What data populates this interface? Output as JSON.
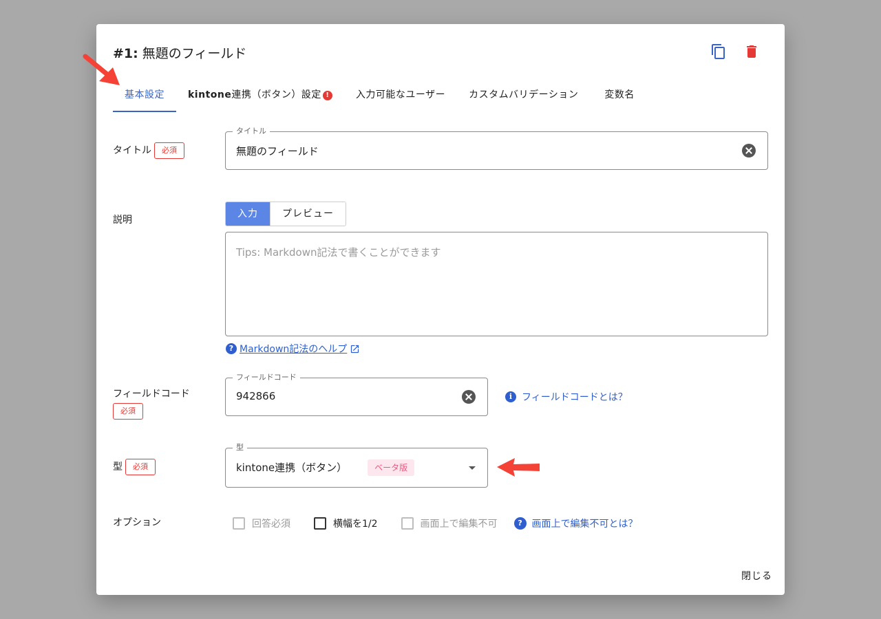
{
  "header": {
    "number": "#1:",
    "title": "無題のフィールド"
  },
  "tabs": [
    {
      "label": "基本設定"
    },
    {
      "bold": "kintone",
      "label": "連携（ボタン）設定",
      "warn": "!"
    },
    {
      "label": "入力可能なユーザー"
    },
    {
      "label": "カスタムバリデーション"
    },
    {
      "label": "変数名"
    }
  ],
  "required_label": "必須",
  "title_field": {
    "label": "タイトル",
    "legend": "タイトル",
    "value": "無題のフィールド"
  },
  "description": {
    "label": "説明",
    "toggle_input": "入力",
    "toggle_preview": "プレビュー",
    "placeholder": "Tips: Markdown記法で書くことができます",
    "help_link": "Markdown記法のヘルプ"
  },
  "field_code": {
    "label": "フィールドコード",
    "legend": "フィールドコード",
    "value": "942866",
    "info_link": "フィールドコードとは？"
  },
  "type_field": {
    "label": "型",
    "legend": "型",
    "value": "kintone連携（ボタン）",
    "badge": "ベータ版"
  },
  "options": {
    "label": "オプション",
    "items": [
      {
        "label": "回答必須",
        "checked": false,
        "disabled": true
      },
      {
        "label": "横幅を1/2",
        "checked": false,
        "disabled": false
      },
      {
        "label": "画面上で編集不可",
        "checked": false,
        "disabled": true
      }
    ],
    "help_link": "画面上で編集不可とは？"
  },
  "footer": {
    "close_label": "閉じる"
  },
  "colors": {
    "accent": "#3a63c8",
    "danger": "#e53935",
    "arrow": "#f44336"
  }
}
